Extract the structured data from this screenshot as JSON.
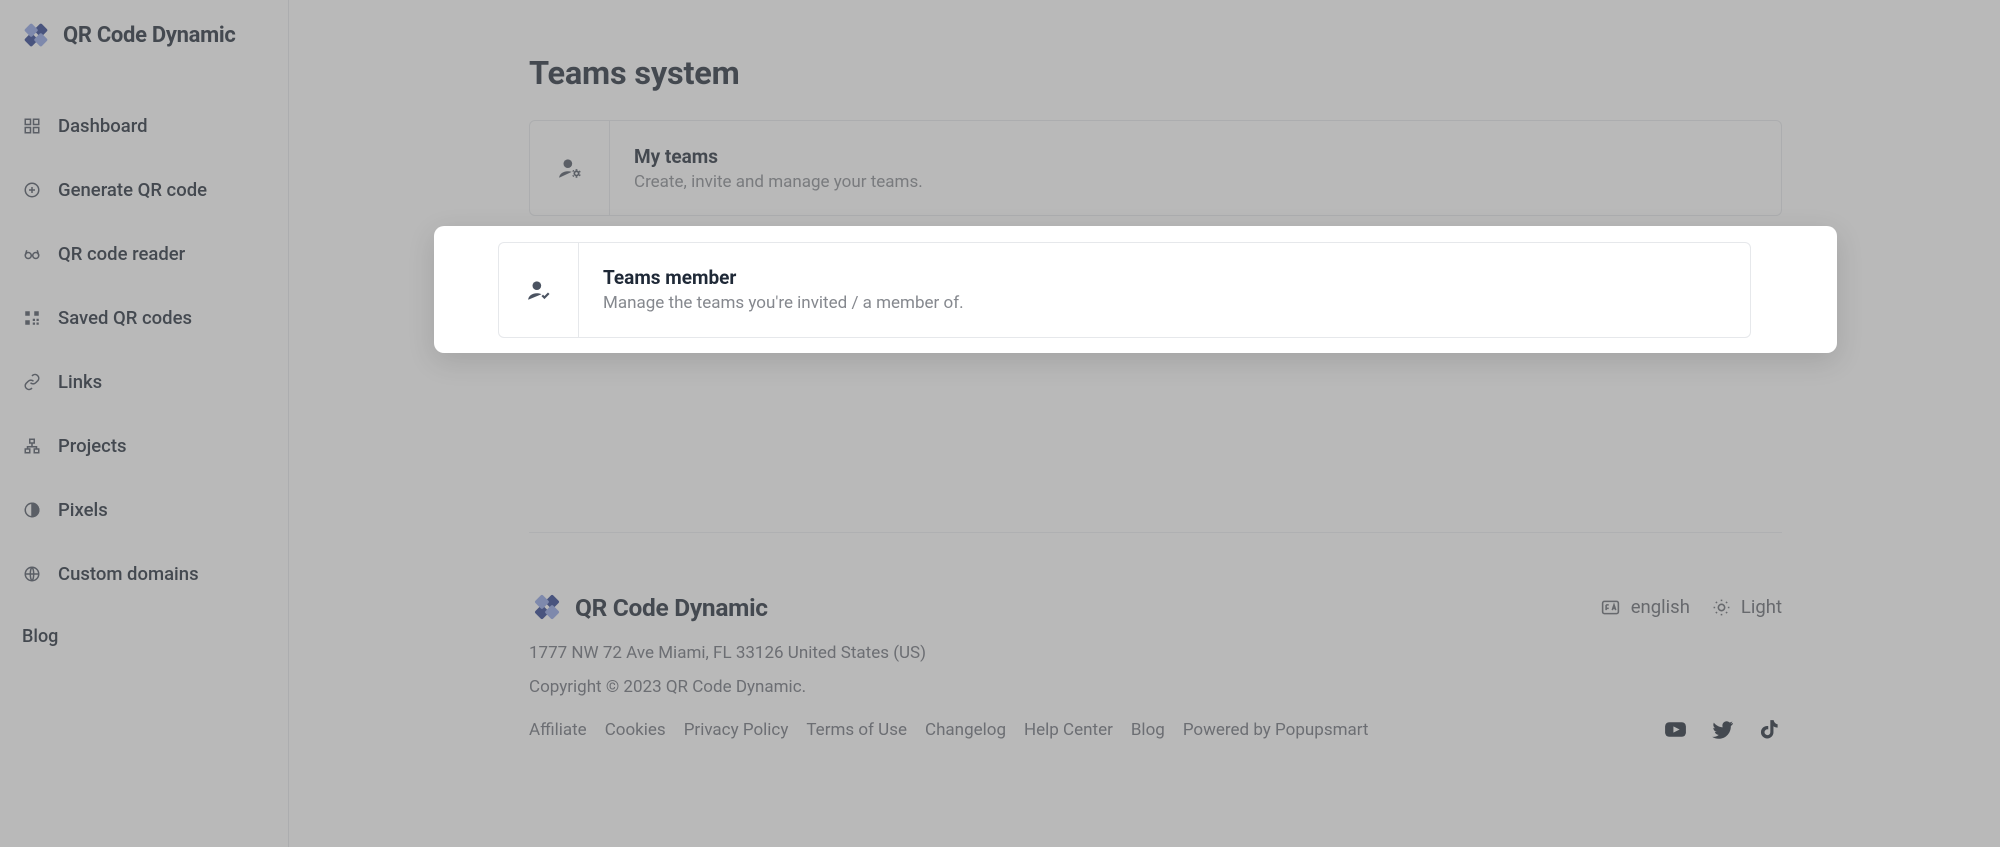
{
  "brand": {
    "name": "QR Code Dynamic"
  },
  "sidebar": {
    "items": [
      {
        "icon": "grid",
        "label": "Dashboard"
      },
      {
        "icon": "plus",
        "label": "Generate QR code"
      },
      {
        "icon": "glasses",
        "label": "QR code reader"
      },
      {
        "icon": "qr",
        "label": "Saved QR codes"
      },
      {
        "icon": "link",
        "label": "Links"
      },
      {
        "icon": "chart",
        "label": "Projects"
      },
      {
        "icon": "circle",
        "label": "Pixels"
      },
      {
        "icon": "globe",
        "label": "Custom domains"
      }
    ],
    "blog_label": "Blog"
  },
  "page": {
    "title": "Teams system"
  },
  "cards": [
    {
      "title": "My teams",
      "sub": "Create, invite and manage your teams."
    },
    {
      "title": "Teams member",
      "sub": "Manage the teams you're invited / a member of."
    }
  ],
  "footer": {
    "brand": "QR Code Dynamic",
    "lang_label": "english",
    "theme_label": "Light",
    "address": "1777 NW 72 Ave Miami, FL 33126 United States (US)",
    "copyright": "Copyright © 2023 QR Code Dynamic.",
    "links": [
      "Affiliate",
      "Cookies",
      "Privacy Policy",
      "Terms of Use",
      "Changelog",
      "Help Center",
      "Blog",
      "Powered by Popupsmart"
    ]
  }
}
